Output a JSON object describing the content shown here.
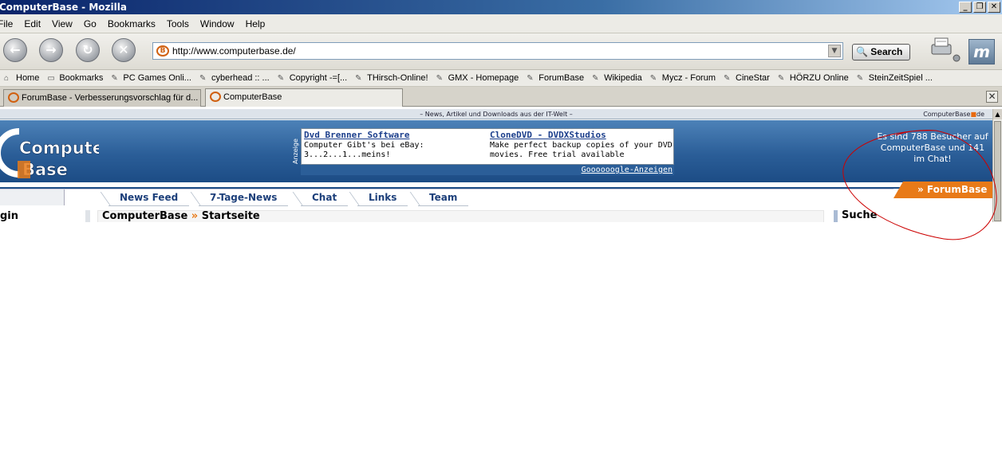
{
  "window": {
    "title": "ComputerBase - Mozilla",
    "buttons": [
      "_",
      "❐",
      "✕"
    ]
  },
  "menu": [
    "File",
    "Edit",
    "View",
    "Go",
    "Bookmarks",
    "Tools",
    "Window",
    "Help"
  ],
  "nav": {
    "back_icon": "back-arrow-icon",
    "forward_icon": "forward-arrow-icon",
    "reload_icon": "reload-icon",
    "stop_icon": "stop-icon",
    "url": "http://www.computerbase.de/",
    "search_label": "Search"
  },
  "bookmarks": [
    {
      "label": "Home",
      "icon": "home-icon"
    },
    {
      "label": "Bookmarks",
      "icon": "folder-icon"
    },
    {
      "label": "PC Games Onli...",
      "icon": "bookmark-icon"
    },
    {
      "label": "cyberhead :: ...",
      "icon": "bookmark-icon"
    },
    {
      "label": "Copyright -=[...",
      "icon": "bookmark-icon"
    },
    {
      "label": "THirsch-Online!",
      "icon": "bookmark-icon"
    },
    {
      "label": "GMX - Homepage",
      "icon": "bookmark-icon"
    },
    {
      "label": "ForumBase",
      "icon": "bookmark-icon"
    },
    {
      "label": "Wikipedia",
      "icon": "bookmark-icon"
    },
    {
      "label": "Mycz - Forum",
      "icon": "bookmark-icon"
    },
    {
      "label": "CineStar",
      "icon": "bookmark-icon"
    },
    {
      "label": "HÖRZU Online",
      "icon": "bookmark-icon"
    },
    {
      "label": "SteinZeitSpiel ...",
      "icon": "bookmark-icon"
    }
  ],
  "tabs": [
    {
      "label": "ForumBase - Verbesserungsvorschlag für d...",
      "active": false
    },
    {
      "label": "ComputerBase",
      "active": true
    }
  ],
  "page": {
    "tagline": "– News, Artikel und Downloads aus der IT-Welt –",
    "site_name_left": "ComputerBase",
    "site_dot": "■",
    "site_name_right": "de",
    "logo_line1": "Computer",
    "logo_line2": "Base",
    "ad": {
      "label": "Anzeige",
      "col1_title": "Dvd Brenner Software",
      "col1_text": "Computer Gibt's bei eBay: 3...2...1...meins!",
      "col2_title": "CloneDVD - DVDXStudios",
      "col2_text": "Make perfect backup copies of your DVD movies. Free trial available",
      "footer": "Goooooogle-Anzeigen"
    },
    "visitors": "Es sind 788 Besucher auf ComputerBase und 141 im Chat!",
    "forumbase_label": "» ForumBase",
    "nav_tabs": [
      "News Feed",
      "7-Tage-News",
      "Chat",
      "Links",
      "Team"
    ],
    "login_label": "gin",
    "breadcrumb_root": "ComputerBase",
    "breadcrumb_sep": "»",
    "breadcrumb_page": "Startseite",
    "search_heading": "Suche"
  },
  "colors": {
    "banner": "#2b5e98",
    "accent_orange": "#e87a18",
    "annotation_red": "#cc0000"
  }
}
